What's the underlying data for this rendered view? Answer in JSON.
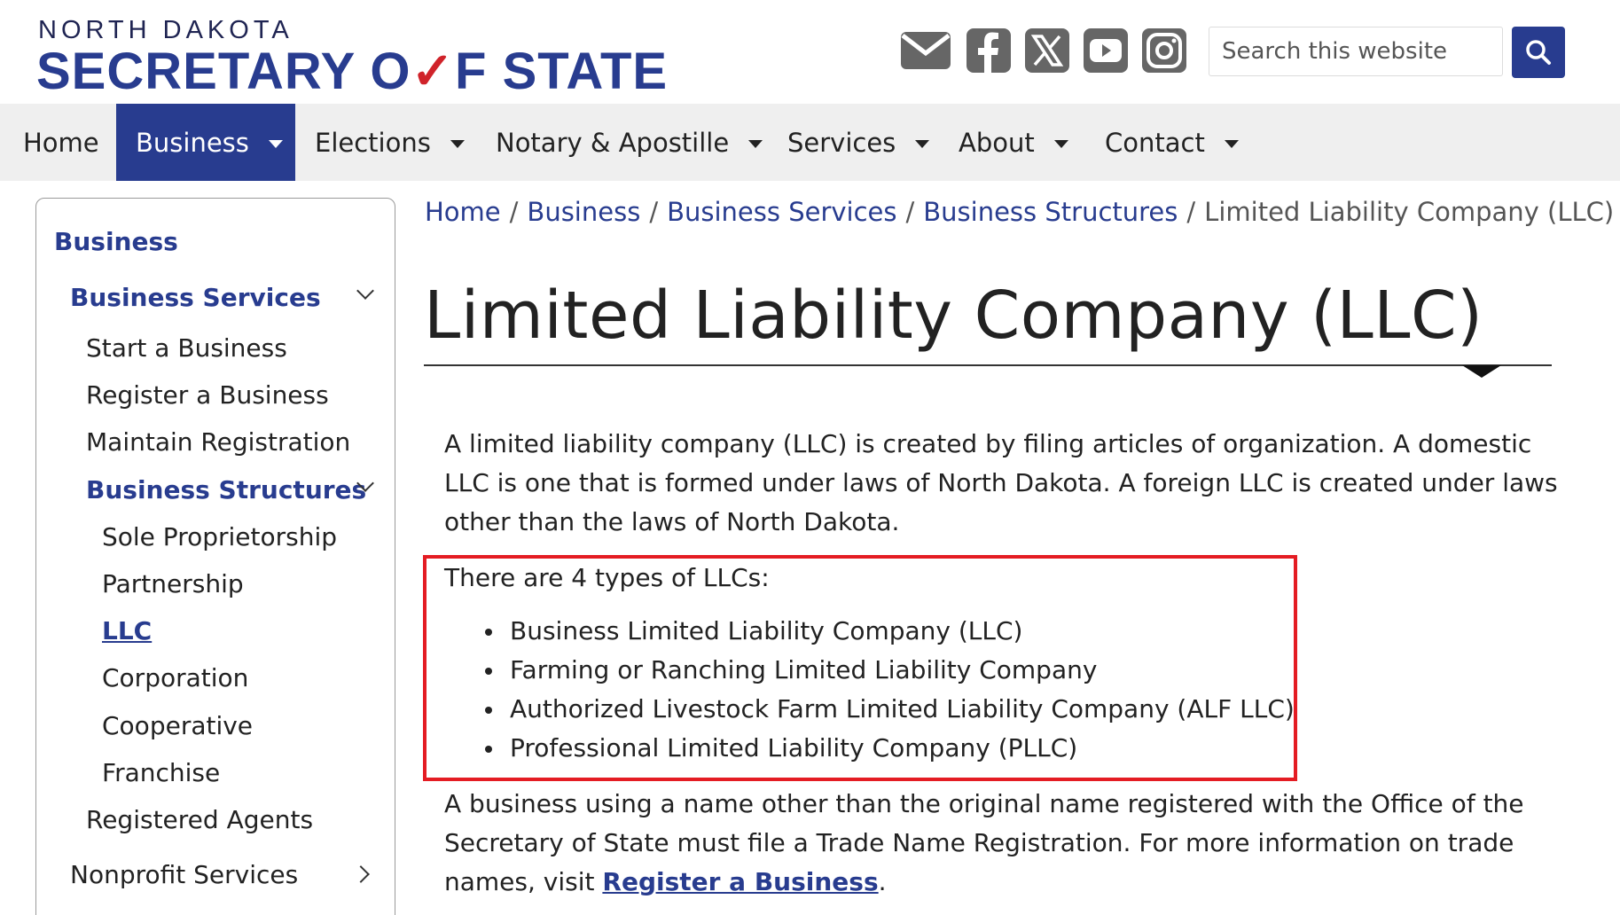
{
  "header": {
    "logo_top": "NORTH DAKOTA",
    "logo_main_before": "SECRETARY O",
    "logo_main_check": "✓",
    "logo_main_after": "F STATE",
    "search_placeholder": "Search this website",
    "social_icons": [
      "email-icon",
      "facebook-icon",
      "x-icon",
      "youtube-icon",
      "instagram-icon"
    ]
  },
  "nav": {
    "items": [
      {
        "label": "Home",
        "dropdown": false
      },
      {
        "label": "Business",
        "dropdown": true,
        "active": true
      },
      {
        "label": "Elections",
        "dropdown": true
      },
      {
        "label": "Notary & Apostille",
        "dropdown": true
      },
      {
        "label": "Services",
        "dropdown": true
      },
      {
        "label": "About",
        "dropdown": true
      },
      {
        "label": "Contact",
        "dropdown": true
      }
    ]
  },
  "sidebar": {
    "heading": "Business",
    "business_services": "Business Services",
    "start": "Start a Business",
    "register": "Register a Business",
    "maintain": "Maintain Registration",
    "structures": "Business Structures",
    "sole": "Sole Proprietorship",
    "partnership": "Partnership",
    "llc": "LLC",
    "corporation": "Corporation",
    "cooperative": "Cooperative",
    "franchise": "Franchise",
    "agents": "Registered Agents",
    "nonprofit": "Nonprofit Services"
  },
  "breadcrumb": {
    "items": [
      "Home",
      "Business",
      "Business Services",
      "Business Structures"
    ],
    "current": "Limited Liability Company (LLC)",
    "separator": "/"
  },
  "main": {
    "title": "Limited Liability Company (LLC)",
    "intro": "A limited liability company (LLC) is created by filing articles of organization. A domestic LLC is one that is formed under laws of North Dakota. A foreign LLC is created under laws other than the laws of North Dakota.",
    "types_intro": "There are 4 types of LLCs:",
    "types": [
      "Business Limited Liability Company (LLC)",
      "Farming or Ranching Limited Liability Company",
      "Authorized Livestock Farm Limited Liability Company (ALF LLC)",
      "Professional Limited Liability Company (PLLC)"
    ],
    "trade_name_text": "A business using a name other than the original name registered with the Office of the Secretary of State must file a Trade Name Registration. For more information on trade names, visit ",
    "trade_name_link": "Register a Business",
    "trade_name_end": "."
  },
  "colors": {
    "brand_blue": "#283c8f",
    "highlight_red": "#e41c23",
    "nav_bg": "#efefef"
  }
}
